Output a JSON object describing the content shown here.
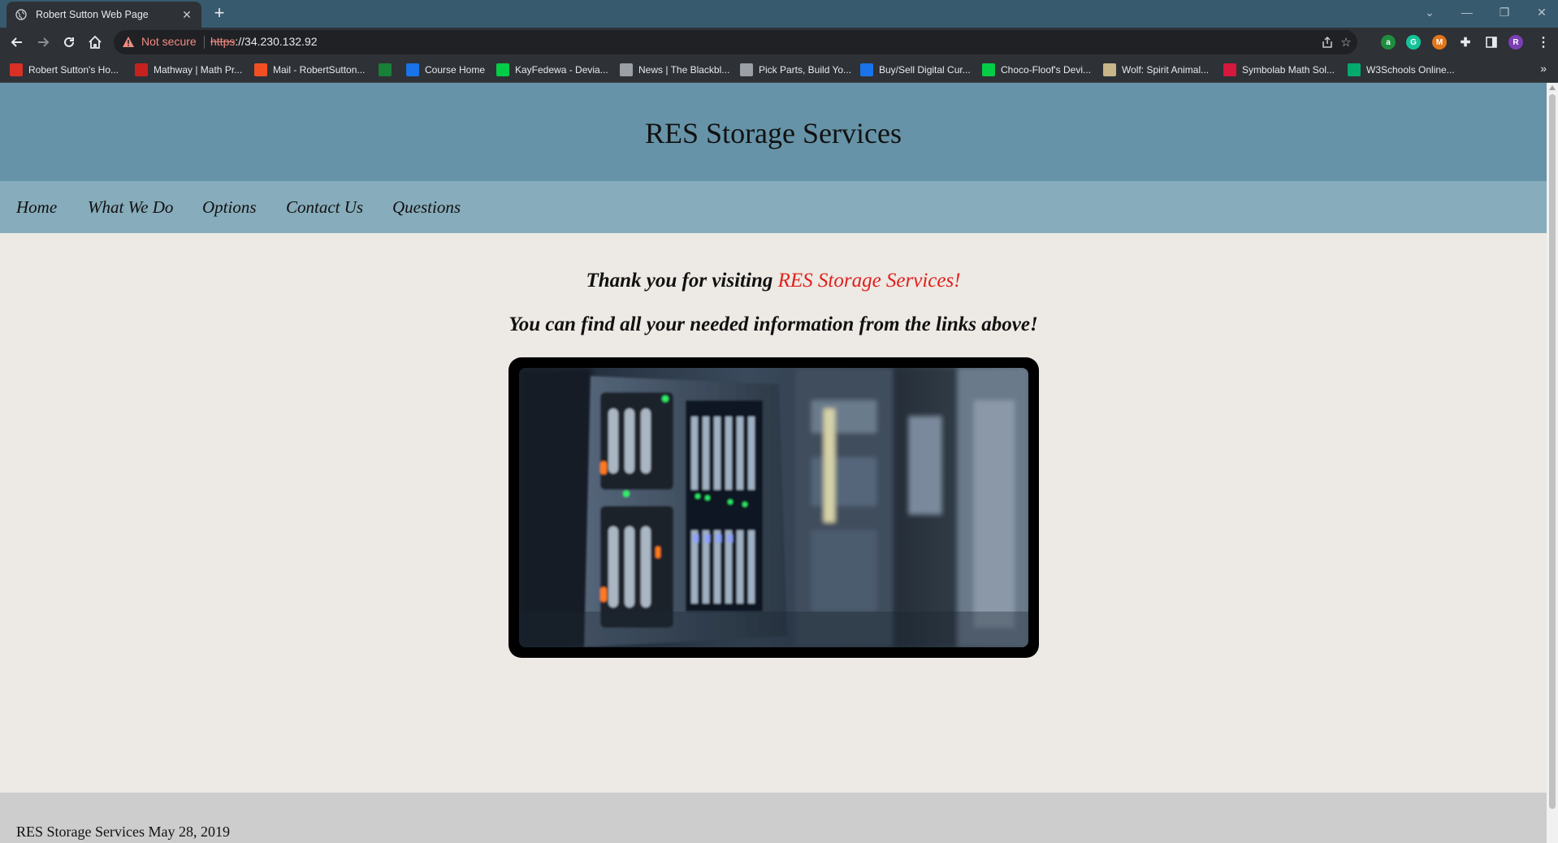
{
  "browser": {
    "tab_title": "Robert Sutton Web Page",
    "security_label": "Not secure",
    "url_scheme": "https",
    "url_rest": "://34.230.132.92",
    "bookmarks": [
      {
        "label": "Robert Sutton's Ho...",
        "icon": "x-icon",
        "color": "#d93025"
      },
      {
        "label": "Mathway | Math Pr...",
        "icon": "mathway-icon",
        "color": "#c5221f"
      },
      {
        "label": "Mail - RobertSutton...",
        "icon": "microsoft-icon",
        "color": "#f25022"
      },
      {
        "label": "",
        "icon": "w-icon",
        "color": "#188038"
      },
      {
        "label": "Course Home",
        "icon": "p-icon",
        "color": "#1a73e8"
      },
      {
        "label": "KayFedewa - Devia...",
        "icon": "deviantart-icon",
        "color": "#05cc47"
      },
      {
        "label": "News | The Blackbl...",
        "icon": "globe-icon",
        "color": "#9aa0a6"
      },
      {
        "label": "Pick Parts, Build Yo...",
        "icon": "pcpartpicker-icon",
        "color": "#9aa0a6"
      },
      {
        "label": "Buy/Sell Digital Cur...",
        "icon": "coinbase-icon",
        "color": "#1a73e8"
      },
      {
        "label": "Choco-Floof's Devi...",
        "icon": "deviantart-icon",
        "color": "#05cc47"
      },
      {
        "label": "Wolf: Spirit Animal...",
        "icon": "wolf-icon",
        "color": "#c8b68a"
      },
      {
        "label": "Symbolab Math Sol...",
        "icon": "symbolab-icon",
        "color": "#d6183d"
      },
      {
        "label": "W3Schools Online...",
        "icon": "w3schools-icon",
        "color": "#04aa6d"
      }
    ]
  },
  "site": {
    "title": "RES Storage Services",
    "nav": [
      "Home",
      "What We Do",
      "Options",
      "Contact Us",
      "Questions"
    ],
    "lead_prefix": "Thank you for visiting ",
    "lead_highlight": "RES Storage Services!",
    "subline": "You can find all your needed information from the links above!",
    "highlight_color": "#e0201c",
    "footer": "RES Storage Services May 28, 2019"
  }
}
